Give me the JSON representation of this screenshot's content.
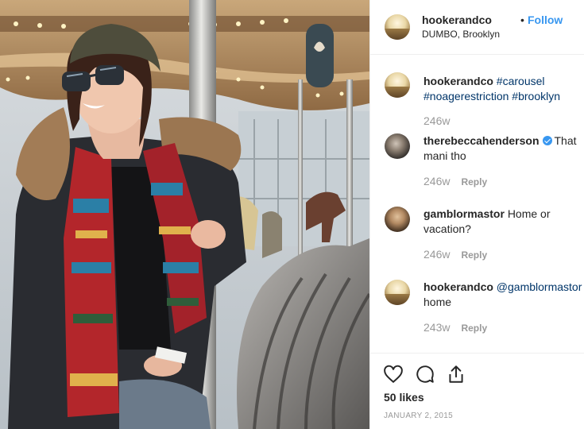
{
  "post": {
    "username": "hookerandco",
    "follow_label": "Follow",
    "separator": "•",
    "location": "DUMBO, Brooklyn"
  },
  "comments": [
    {
      "username": "hookerandco",
      "text_parts": [
        "#carousel",
        "#noagerestriction",
        "#brooklyn"
      ],
      "time": "246w",
      "reply_label": ""
    },
    {
      "username": "therebeccahenderson",
      "verified": true,
      "text": "That mani tho",
      "time": "246w",
      "reply_label": "Reply"
    },
    {
      "username": "gamblormastor",
      "text": "Home or vacation?",
      "time": "246w",
      "reply_label": "Reply"
    },
    {
      "username": "hookerandco",
      "mention": "@gamblormastor",
      "text": "home",
      "time": "243w",
      "reply_label": "Reply"
    }
  ],
  "footer": {
    "likes": "50 likes",
    "date": "JANUARY 2, 2015",
    "icons": [
      "heart-icon",
      "comment-icon",
      "share-icon"
    ]
  },
  "colors": {
    "link_blue": "#3897f0",
    "hashtag": "#003569",
    "muted": "#999999"
  }
}
